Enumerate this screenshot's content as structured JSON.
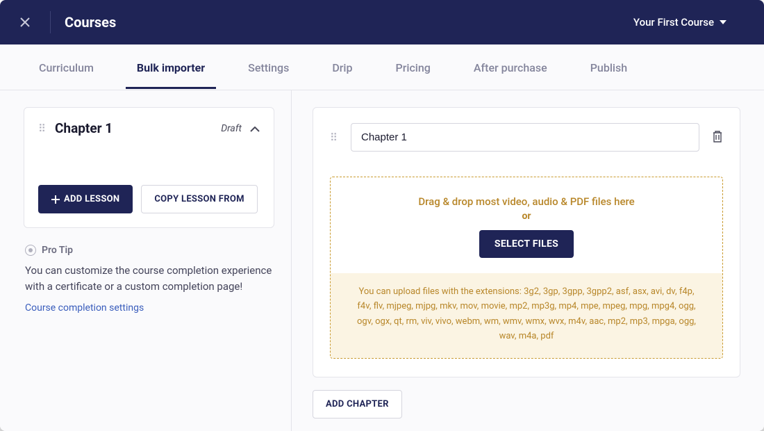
{
  "header": {
    "title": "Courses",
    "course": "Your First Course"
  },
  "tabs": [
    {
      "label": "Curriculum",
      "active": false
    },
    {
      "label": "Bulk importer",
      "active": true
    },
    {
      "label": "Settings",
      "active": false
    },
    {
      "label": "Drip",
      "active": false
    },
    {
      "label": "Pricing",
      "active": false
    },
    {
      "label": "After purchase",
      "active": false
    },
    {
      "label": "Publish",
      "active": false
    }
  ],
  "chapter_panel": {
    "name": "Chapter 1",
    "status": "Draft",
    "add_lesson_label": "ADD LESSON",
    "copy_lesson_label": "COPY LESSON FROM"
  },
  "tip": {
    "label": "Pro Tip",
    "body": "You can customize the course completion experience with a certificate or a custom completion page!",
    "link": "Course completion settings"
  },
  "importer": {
    "chapter_input_value": "Chapter 1",
    "drop_text": "Drag & drop most video, audio & PDF files here",
    "or": "or",
    "select_label": "SELECT FILES",
    "extensions_text": "You can upload files with the extensions: 3g2, 3gp, 3gpp, 3gpp2, asf, asx, avi, dv, f4p, f4v, flv, mjpeg, mjpg, mkv, mov, movie, mp2, mp3g, mp4, mpe, mpeg, mpg, mpg4, ogg, ogv, ogx, qt, rm, viv, vivo, webm, wm, wmv, wmx, wvx, m4v, aac, mp2, mp3, mpga, ogg, wav, m4a, pdf",
    "add_chapter_label": "ADD CHAPTER"
  }
}
